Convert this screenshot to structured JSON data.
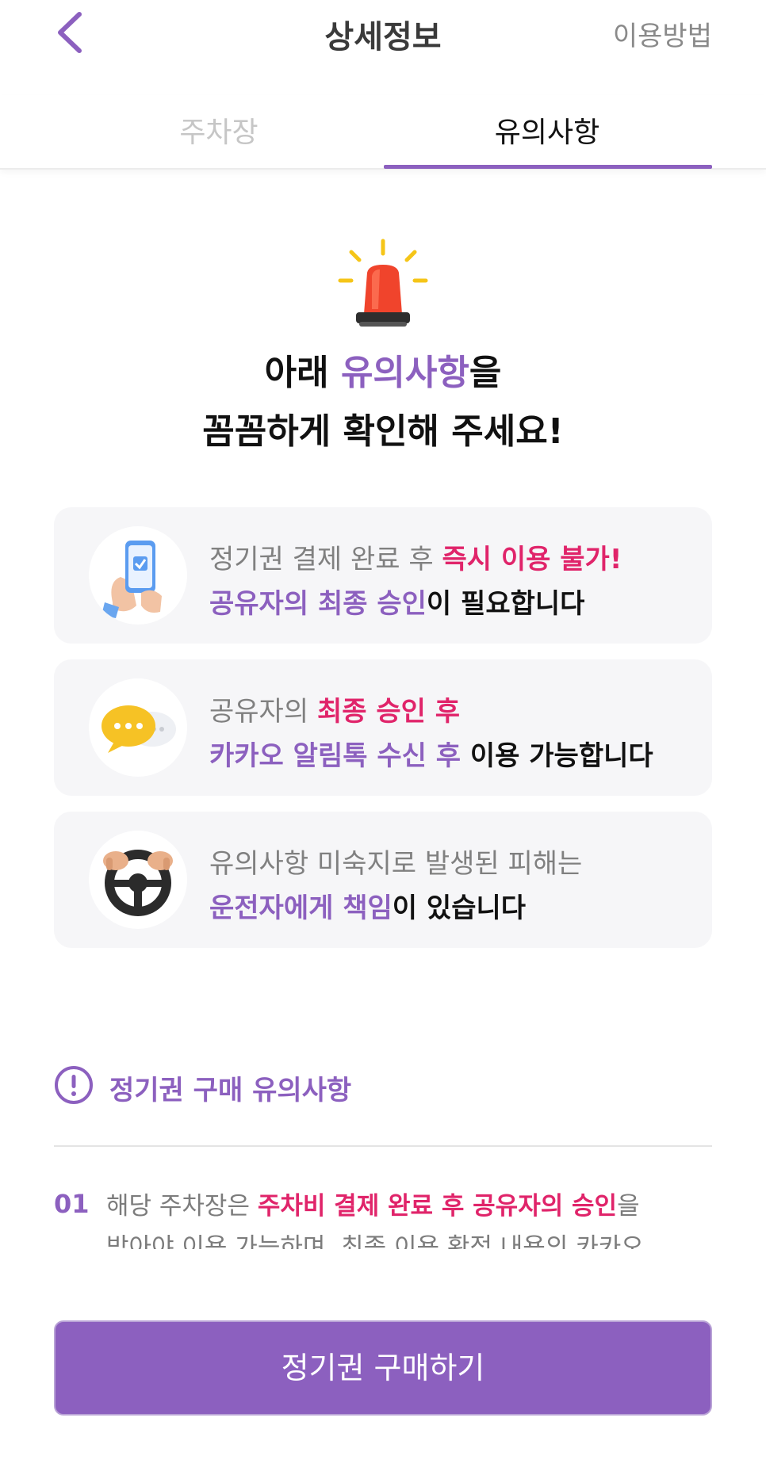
{
  "header": {
    "title": "상세정보",
    "help_link": "이용방법"
  },
  "tabs": [
    {
      "label": "주차장",
      "active": false
    },
    {
      "label": "유의사항",
      "active": true
    }
  ],
  "headline": {
    "line1_pre": "아래 ",
    "line1_accent": "유의사항",
    "line1_post": "을",
    "line2": "꼼꼼하게 확인해 주세요!"
  },
  "cards": [
    {
      "icon": "phone-approval-icon",
      "line1_gray": "정기권 결제 완료 후 ",
      "line1_pink": "즉시 이용 불가!",
      "line2_purple": "공유자의 최종 승인",
      "line2_black": "이 필요합니다"
    },
    {
      "icon": "kakao-talk-bubble-icon",
      "line1_gray": "공유자의 ",
      "line1_pink": "최종 승인 후",
      "line2_purple": "카카오 알림톡 수신 후",
      "line2_black": " 이용 가능합니다"
    },
    {
      "icon": "steering-wheel-icon",
      "line1_gray": "유의사항 미숙지로 발생된 피해는",
      "line1_pink": "",
      "line2_purple": "운전자에게 책임",
      "line2_black": "이 있습니다"
    }
  ],
  "section": {
    "title": "정기권 구매 유의사항",
    "icon": "exclamation-circle-icon"
  },
  "notices": [
    {
      "number": "01",
      "line1_pre": "해당 주차장은 ",
      "line1_pink": "주차비 결제 완료 후 공유자의 승인",
      "line1_post": "을",
      "line2": "받아야 이용 가능하며, 최종 이용 확정 내용의 카카오"
    }
  ],
  "cta": {
    "label": "정기권 구매하기"
  },
  "colors": {
    "accent": "#8c60bf",
    "highlight": "#e0246a"
  }
}
